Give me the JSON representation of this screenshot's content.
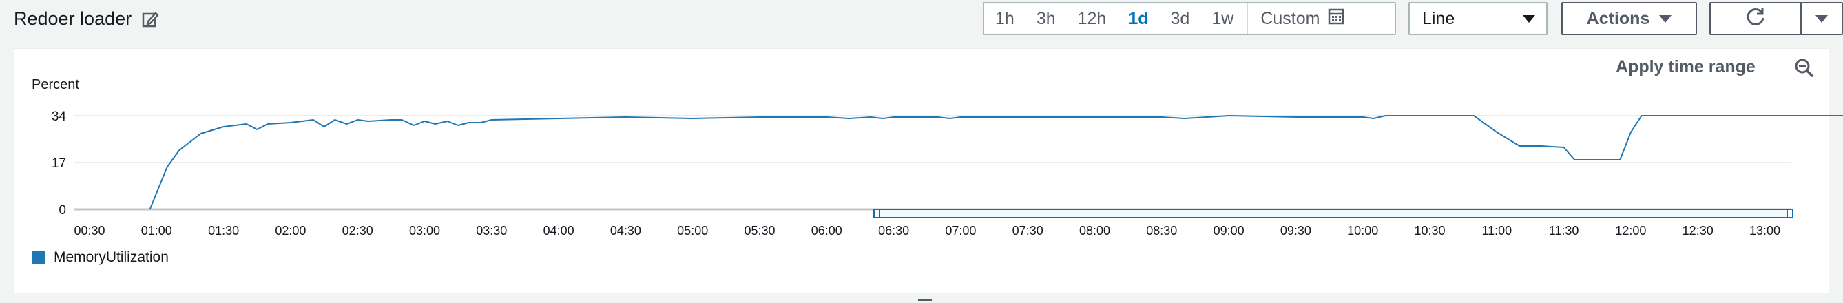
{
  "header": {
    "title": "Redoer loader"
  },
  "time_range": {
    "options": [
      "1h",
      "3h",
      "12h",
      "1d",
      "3d",
      "1w"
    ],
    "active": "1d",
    "custom_label": "Custom"
  },
  "view_select": {
    "value": "Line"
  },
  "actions": {
    "label": "Actions"
  },
  "apply_time_range": "Apply time range",
  "colors": {
    "series": "#1f77b4",
    "accent": "#0073bb",
    "selection": "#0073bb"
  },
  "icons": [
    "edit-icon",
    "calendar-icon",
    "refresh-icon",
    "chevron-down-icon",
    "zoom-out-icon"
  ],
  "chart_data": {
    "type": "line",
    "ylabel": "Percent",
    "yticks": [
      "0",
      "17",
      "34"
    ],
    "ylim": [
      0,
      34
    ],
    "xticks": [
      "00:30",
      "01:00",
      "01:30",
      "02:00",
      "02:30",
      "03:00",
      "03:30",
      "04:00",
      "04:30",
      "05:00",
      "05:30",
      "06:00",
      "06:30",
      "07:00",
      "07:30",
      "08:00",
      "08:30",
      "09:00",
      "09:30",
      "10:00",
      "10:30",
      "11:00",
      "11:30",
      "12:00",
      "12:30",
      "13:00"
    ],
    "grid": true,
    "legend_position": "bottom-left",
    "series": [
      {
        "name": "MemoryUtilization",
        "points": [
          [
            0.95,
            0
          ],
          [
            1.08,
            15.5
          ],
          [
            1.17,
            21.5
          ],
          [
            1.33,
            27.5
          ],
          [
            1.5,
            30
          ],
          [
            1.67,
            31
          ],
          [
            1.75,
            29
          ],
          [
            1.83,
            31
          ],
          [
            2.0,
            31.5
          ],
          [
            2.17,
            32.5
          ],
          [
            2.25,
            30
          ],
          [
            2.33,
            32.5
          ],
          [
            2.42,
            31
          ],
          [
            2.5,
            32.5
          ],
          [
            2.58,
            32
          ],
          [
            2.75,
            32.5
          ],
          [
            2.83,
            32.5
          ],
          [
            2.92,
            30.5
          ],
          [
            3.0,
            32
          ],
          [
            3.08,
            31
          ],
          [
            3.17,
            32
          ],
          [
            3.25,
            30.5
          ],
          [
            3.33,
            31.5
          ],
          [
            3.42,
            31.5
          ],
          [
            3.5,
            32.5
          ],
          [
            4.0,
            33
          ],
          [
            4.5,
            33.5
          ],
          [
            5.0,
            33
          ],
          [
            5.5,
            33.5
          ],
          [
            6.0,
            33.5
          ],
          [
            6.17,
            33
          ],
          [
            6.33,
            33.5
          ],
          [
            6.42,
            33
          ],
          [
            6.5,
            33.5
          ],
          [
            6.83,
            33.5
          ],
          [
            6.92,
            33
          ],
          [
            7.0,
            33.5
          ],
          [
            7.5,
            33.5
          ],
          [
            8.0,
            33.5
          ],
          [
            8.5,
            33.5
          ],
          [
            8.67,
            33
          ],
          [
            9.0,
            34
          ],
          [
            9.5,
            33.5
          ],
          [
            10.0,
            33.5
          ],
          [
            10.08,
            33
          ],
          [
            10.17,
            34
          ],
          [
            10.5,
            34
          ],
          [
            10.83,
            34
          ],
          [
            11.0,
            28
          ],
          [
            11.17,
            23
          ],
          [
            11.33,
            23
          ],
          [
            11.5,
            22.5
          ],
          [
            11.58,
            18
          ],
          [
            11.75,
            18
          ],
          [
            11.92,
            18
          ],
          [
            12.0,
            28
          ],
          [
            12.08,
            34
          ],
          [
            12.5,
            34
          ],
          [
            13.0,
            34
          ],
          [
            13.5,
            34
          ],
          [
            14.0,
            34
          ]
        ]
      }
    ]
  }
}
